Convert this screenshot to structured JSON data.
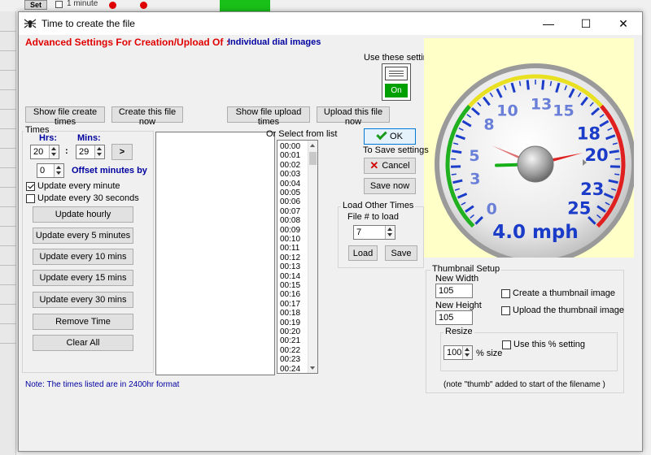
{
  "background": {
    "set_label": "Set",
    "minute_label": "1 minute"
  },
  "window": {
    "title": "Time to create the file",
    "controls": {
      "minimize": "—",
      "maximize": "☐",
      "close": "✕"
    }
  },
  "header": {
    "prefix": "Advanced Settings For Creation/Upload Of :",
    "target": "Individual dial images"
  },
  "use_settings": {
    "label": "Use these setting:",
    "switch_state": "On"
  },
  "top_buttons": {
    "show_create": "Show file create times",
    "create_now": "Create this file now",
    "show_upload": "Show file upload times",
    "upload_now": "Upload this file now"
  },
  "times": {
    "group_label": "Times",
    "hrs_label": "Hrs:",
    "mins_label": "Mins:",
    "hrs_value": "20",
    "colon": ":",
    "mins_value": "29",
    "add_button": ">",
    "offset_value": "0",
    "offset_label": "Offset minutes by",
    "update_every_minute": "Update every minute",
    "update_every_minute_checked": true,
    "update_every_30_seconds": "Update every 30 seconds",
    "update_every_30_seconds_checked": false,
    "buttons": [
      "Update hourly",
      "Update every 5 minutes",
      "Update every 10 mins",
      "Update every 15 mins",
      "Update every 30 mins",
      "Remove Time",
      "Clear All"
    ]
  },
  "list": {
    "label": "Or Select from list",
    "items": [
      "00:00",
      "00:01",
      "00:02",
      "00:03",
      "00:04",
      "00:05",
      "00:06",
      "00:07",
      "00:08",
      "00:09",
      "00:10",
      "00:11",
      "00:12",
      "00:13",
      "00:14",
      "00:15",
      "00:16",
      "00:17",
      "00:18",
      "00:19",
      "00:20",
      "00:21",
      "00:22",
      "00:23",
      "00:24"
    ]
  },
  "actions": {
    "ok": "OK",
    "save_settings_label": "To Save settings",
    "cancel": "Cancel",
    "save_now": "Save now"
  },
  "load_other": {
    "group_label": "Load Other Times",
    "file_label": "File # to load",
    "file_value": "7",
    "load": "Load",
    "save": "Save"
  },
  "gauge": {
    "ticks": [
      "0",
      "3",
      "5",
      "8",
      "10",
      "13",
      "15",
      "18",
      "20",
      "23",
      "25"
    ],
    "readout": "4.0 mph",
    "value": 4.0,
    "max": 25
  },
  "thumbnail": {
    "group_label": "Thumbnail Setup",
    "new_width_label": "New Width",
    "new_width_value": "105",
    "new_height_label": "New Height",
    "new_height_value": "105",
    "create_thumb": "Create a thumbnail image",
    "create_thumb_checked": false,
    "upload_thumb": "Upload the thumbnail image",
    "upload_thumb_checked": false,
    "resize_label": "Resize",
    "resize_value": "100",
    "size_label": "% size",
    "use_percent": "Use this % setting",
    "use_percent_checked": false,
    "note": "(note \"thumb\" added to start of the filename )"
  },
  "footer_note": "Note: The times listed are in 2400hr format"
}
